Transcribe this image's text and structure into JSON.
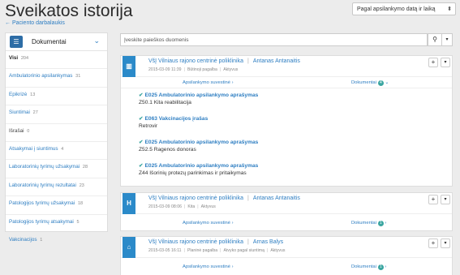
{
  "page": {
    "title": "Sveikatos istorija",
    "back_link": "← Paciento darbalaukis"
  },
  "sort": {
    "label": "Pagal apsilankymo datą ir laiką"
  },
  "search": {
    "placeholder": "Įveskite paieškos duomenis"
  },
  "sidebar": {
    "title": "Dokumentai",
    "items": [
      {
        "label": "Visi",
        "count": "204"
      },
      {
        "label": "Ambulatorinio apsilankymas",
        "count": "31"
      },
      {
        "label": "Epikrizė",
        "count": "13"
      },
      {
        "label": "Siuntimai",
        "count": "27"
      },
      {
        "label": "Išrašai",
        "count": "0"
      },
      {
        "label": "Atsakymai į siuntimus",
        "count": "4"
      },
      {
        "label": "Laboratorinių tyrimų užsakymai",
        "count": "28"
      },
      {
        "label": "Laboratorinių tyrimų rezultatai",
        "count": "23"
      },
      {
        "label": "Patologijos tyrimų užsakymai",
        "count": "18"
      },
      {
        "label": "Patologijos tyrimų atsakymai",
        "count": "5"
      },
      {
        "label": "Vakcinacijos",
        "count": "1"
      }
    ]
  },
  "cards": [
    {
      "icon": "clinic-icon",
      "org": "VšĮ Vilniaus rajono centrinė poliklinika",
      "doctor": "Antanas Antanaitis",
      "datetime": "2015-03-09 11:39",
      "type": "Būtinoji pagalba",
      "status": "Aktyvus",
      "summary_label": "Apsilankymo suvestinė",
      "docs_label": "Dokumentai",
      "docs_count": "4",
      "documents": [
        {
          "title": "E025 Ambulatorinio apsilankymo aprašymas",
          "sub": "Z50.1 Kita reabilitacija"
        },
        {
          "title": "E063 Vakcinacijos įrašas",
          "sub": "Retrovir"
        },
        {
          "title": "E025 Ambulatorinio apsilankymo aprašymas",
          "sub": "Z52.5 Ragenos donoras"
        },
        {
          "title": "E025 Ambulatorinio apsilankymo aprašymas",
          "sub": "Z44 Išorinių protezų parinkimas ir pritaikymas"
        }
      ]
    },
    {
      "icon": "hospital-icon",
      "org": "VšĮ Vilniaus rajono centrinė poliklinika",
      "doctor": "Antanas Antanaitis",
      "datetime": "2015-03-09 08:06",
      "type": "Kita",
      "status": "Aktyvus",
      "summary_label": "Apsilankymo suvestinė",
      "docs_label": "Dokumentai",
      "docs_count": "1"
    },
    {
      "icon": "home-icon",
      "org": "VšĮ Vilniaus rajono centrinė poliklinika",
      "doctor": "Arnas Balys",
      "datetime": "2015-03-05 16:11",
      "type": "Planinė pagalba",
      "extra": "Atvyko pagal siuntimą",
      "status": "Aktyvus",
      "summary_label": "Apsilankymo suvestinė",
      "docs_label": "Dokumentai",
      "docs_count": "1"
    }
  ]
}
